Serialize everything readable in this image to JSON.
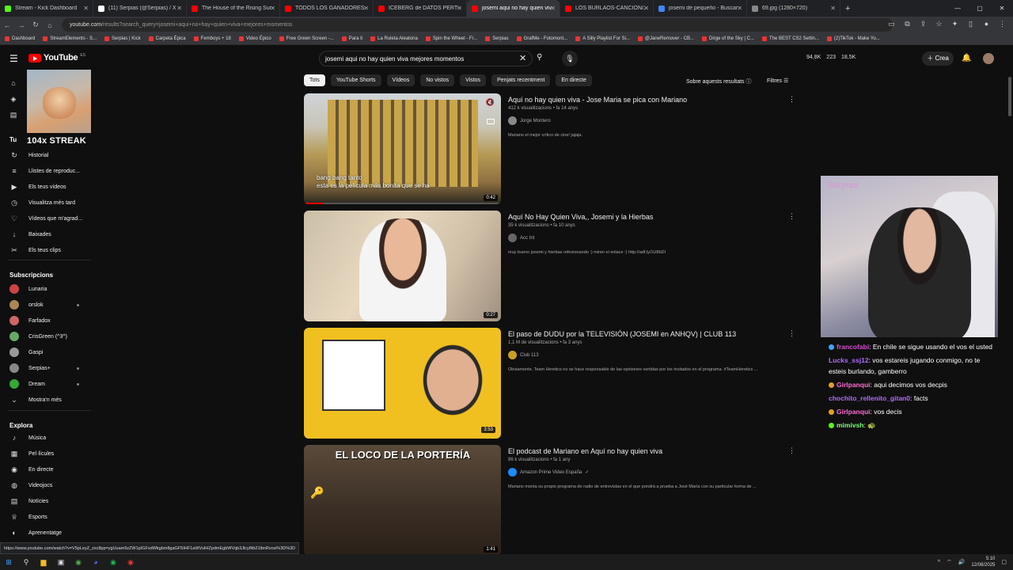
{
  "browser": {
    "tabs": [
      {
        "label": "Stream - Kick Dashboard",
        "color": "#53fc18",
        "active": false
      },
      {
        "label": "(11) Serpias (@Serpias) / X",
        "color": "#ffffff",
        "active": false
      },
      {
        "label": "The House of the Rising Sun (o",
        "color": "#ff0000",
        "active": false
      },
      {
        "label": "TODOS LOS GANADORES DE H",
        "color": "#ff0000",
        "active": false
      },
      {
        "label": "ICEBERG de DATOS PERTURBA",
        "color": "#ff0000",
        "active": false
      },
      {
        "label": "josemi aqui no hay quien viva",
        "color": "#ff0000",
        "active": true
      },
      {
        "label": "LOS BURLAOS-CANCIÓN/JOSE",
        "color": "#ff0000",
        "active": false
      },
      {
        "label": "josemi de pequeño - Buscar co",
        "color": "#4285f4",
        "active": false
      },
      {
        "label": "69.jpg (1280×720)",
        "color": "#888888",
        "active": false
      }
    ],
    "url_main": "youtube.com",
    "url_tail": "/results?search_query=josemi+aqui+no+hay+quien+viva+mejores+momentos",
    "bookmarks": [
      "Dashboard",
      "StreamElements - S...",
      "Serpias | Kick",
      "Carpeta Épica",
      "Femboys + 18",
      "Video Épico",
      "Free Green Screen -...",
      "Para ti",
      "La Ruleta Aleatoria",
      "Spin the Wheel - Fr...",
      "Serpias",
      "GrafMe - Fotomont...",
      "A Silly Playlist For Si...",
      "@JaneRemover - CB...",
      "Dirge of the Sky | C...",
      "The BEST CS2 Settin...",
      "(2)TikTok - Make Yo..."
    ]
  },
  "header": {
    "logo_text": "YouTube",
    "logo_sup": "ES",
    "search_value": "josemi aqui no hay quien viva mejores momentos",
    "stats": [
      "94,8K",
      "223",
      "18,5K"
    ],
    "create_label": "Crea"
  },
  "sidebar": {
    "streak": "104x STREAK",
    "you_label": "Tu",
    "you_items": [
      {
        "label": "Historial",
        "icon": "↻"
      },
      {
        "label": "Llistes de reproduc...",
        "icon": "≡"
      },
      {
        "label": "Els teus vídeos",
        "icon": "▶"
      },
      {
        "label": "Visualitza més tard",
        "icon": "◷"
      },
      {
        "label": "Vídeos que m'agrad...",
        "icon": "♡"
      },
      {
        "label": "Baixades",
        "icon": "↓"
      },
      {
        "label": "Els teus clips",
        "icon": "✂"
      }
    ],
    "subs_label": "Subscripcions",
    "subs": [
      {
        "label": "Lunaria",
        "color": "#c44"
      },
      {
        "label": "orslok",
        "color": "#aa8855"
      },
      {
        "label": "Farfadox",
        "color": "#c66"
      },
      {
        "label": "CrisGreen (^3^)",
        "color": "#6a6"
      },
      {
        "label": "Gaspi",
        "color": "#999"
      },
      {
        "label": "Serpias+",
        "color": "#888"
      },
      {
        "label": "Dream",
        "color": "#3a3"
      }
    ],
    "show_more": "Mostra'n més",
    "explore_label": "Explora",
    "explore": [
      {
        "label": "Música",
        "icon": "♪"
      },
      {
        "label": "Pel·lícules",
        "icon": "▦"
      },
      {
        "label": "En directe",
        "icon": "◉"
      },
      {
        "label": "Videojocs",
        "icon": "◍"
      },
      {
        "label": "Notícies",
        "icon": "▤"
      },
      {
        "label": "Esports",
        "icon": "♕"
      },
      {
        "label": "Aprenentatge",
        "icon": "◐"
      }
    ]
  },
  "chips": [
    "Tots",
    "YouTube Shorts",
    "Vídeos",
    "No vistos",
    "Vistos",
    "Penjats recentment",
    "En directe"
  ],
  "about_results": "Sobre aquests resultats",
  "filters_label": "Filtres",
  "results": [
    {
      "title": "Aquí no hay quien viva - Jose Maria se pica con Mariano",
      "meta": "412 k visualitzacions • fa 14 anys",
      "channel": "Jorge Montero",
      "chan_color": "#888888",
      "desc": "Mariano el mejor crítico de cine! jajaja.",
      "duration": "0:42",
      "subtitle1": "bang bang tanto",
      "subtitle2": "esta es la película más bonita que se ha"
    },
    {
      "title": "Aquí No Hay Quien Viva,, Josemi y la Hierbas",
      "meta": "35 k visualitzacions • fa 10 anys",
      "channel": "Acc Int",
      "chan_color": "#666666",
      "desc": "muy bueno josemi y hierbas refexionando :) miren el enlace :) http://adf.ly/1U8bDI",
      "duration": "0:27"
    },
    {
      "title": "El paso de DUDU por la TELEVISIÓN (JOSEMI en ANHQV) | CLUB 113",
      "meta": "1,1 M de visualitzacions • fa 3 anys",
      "channel": "Club 113",
      "chan_color": "#c8a020",
      "desc": "Obviamente, Team Heretics no se hace responsable de las opiniones vertidas por los invitados en el programa. #TeamHeretics ...",
      "duration": "3:53"
    },
    {
      "title": "El podcast de Mariano en Aquí no hay quien viva",
      "meta": "86 k visualitzacions • fa 1 any",
      "channel": "Amazon Prime Video España",
      "chan_color": "#1a8cff",
      "desc": "Mariano monta su propio programa de radio de entrevistas en el que pondrá a prueba a José María con su particular forma de ...",
      "duration": "1:41",
      "thumb_text": "EL LOCO DE LA PORTERÍA"
    }
  ],
  "webcam_logo": "Serpias",
  "chat": [
    {
      "user": "francofabi",
      "color": "#d64bd6",
      "badge": "#3ea6ff",
      "text": ": En chile se sigue usando el vos el usted"
    },
    {
      "user": "Lucks_ssj12",
      "color": "#b36bff",
      "badge": "",
      "text": ": vos estareis jugando conmigo, no te esteis burlando, gamberro"
    },
    {
      "user": "Girlpanqui",
      "color": "#ff6bd6",
      "badge": "#e0a020",
      "text": ": aqui decimos vos decpis"
    },
    {
      "user": "chochito_rellenito_gitan0",
      "color": "#b36bff",
      "badge": "",
      "text": ": facts"
    },
    {
      "user": "Girlpanqui",
      "color": "#ff6bd6",
      "badge": "#e0a020",
      "text": ": vos decis"
    },
    {
      "user": "mimivsh",
      "color": "#7cff7c",
      "badge": "#53fc18",
      "text": ": 🐢"
    }
  ],
  "status_url": "https://www.youtube.com/watch?v=V5pLeyZ_zxc8pp=ygUuam9zZW1pIGFxdWkgbm8gaGF5IHF1aWVuIHZpdmEgbWVqb3Jlcy8tb21lbnRvcw%3D%3D",
  "clock": {
    "time": "5:10",
    "date": "12/08/2025"
  }
}
